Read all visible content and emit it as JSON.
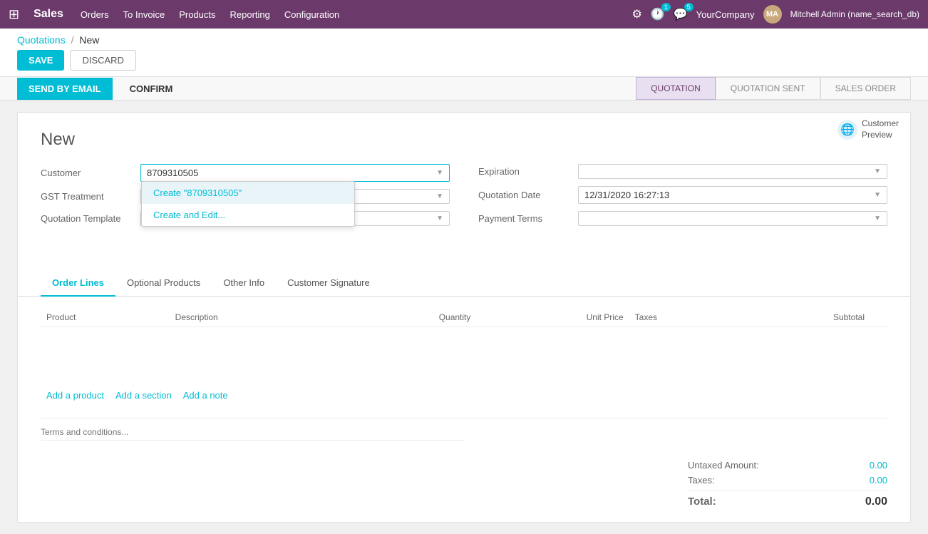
{
  "topnav": {
    "app_grid_icon": "⊞",
    "brand": "Sales",
    "menu_items": [
      {
        "label": "Orders",
        "id": "orders"
      },
      {
        "label": "To Invoice",
        "id": "to-invoice"
      },
      {
        "label": "Products",
        "id": "products"
      },
      {
        "label": "Reporting",
        "id": "reporting"
      },
      {
        "label": "Configuration",
        "id": "configuration"
      }
    ],
    "settings_icon": "⚙",
    "activity_count": "1",
    "messages_count": "5",
    "company": "YourCompany",
    "user": "Mitchell Admin (name_search_db)"
  },
  "breadcrumb": {
    "parent": "Quotations",
    "sep": "/",
    "current": "New"
  },
  "actions": {
    "save_label": "SAVE",
    "discard_label": "DISCARD"
  },
  "statusbar": {
    "send_email_label": "SEND BY EMAIL",
    "confirm_label": "CONFIRM",
    "steps": [
      {
        "label": "QUOTATION",
        "active": true
      },
      {
        "label": "QUOTATION SENT",
        "active": false
      },
      {
        "label": "SALES ORDER",
        "active": false
      }
    ]
  },
  "form": {
    "title": "New",
    "customer_preview_label": "Customer\nPreview",
    "fields_left": [
      {
        "label": "Customer",
        "value": "8709310505",
        "id": "customer",
        "has_dropdown": true
      },
      {
        "label": "GST Treatment",
        "value": "",
        "id": "gst-treatment",
        "has_dropdown": true
      },
      {
        "label": "Quotation Template",
        "value": "",
        "id": "quotation-template",
        "has_dropdown": true
      }
    ],
    "fields_right": [
      {
        "label": "Expiration",
        "value": "",
        "id": "expiration",
        "has_dropdown": true
      },
      {
        "label": "Quotation Date",
        "value": "12/31/2020 16:27:13",
        "id": "quotation-date",
        "has_dropdown": true
      },
      {
        "label": "Payment Terms",
        "value": "",
        "id": "payment-terms",
        "has_dropdown": true
      }
    ],
    "dropdown": {
      "items": [
        {
          "label": "Create \"8709310505\"",
          "highlighted": true,
          "id": "create-customer"
        },
        {
          "label": "Create and Edit...",
          "highlighted": false,
          "id": "create-edit"
        }
      ]
    },
    "tabs": [
      {
        "label": "Order Lines",
        "active": true
      },
      {
        "label": "Optional Products",
        "active": false
      },
      {
        "label": "Other Info",
        "active": false
      },
      {
        "label": "Customer Signature",
        "active": false
      }
    ],
    "table": {
      "columns": [
        {
          "label": "Product",
          "align": "left"
        },
        {
          "label": "Description",
          "align": "left"
        },
        {
          "label": "Quantity",
          "align": "right"
        },
        {
          "label": "Unit Price",
          "align": "right"
        },
        {
          "label": "Taxes",
          "align": "left"
        },
        {
          "label": "Subtotal",
          "align": "right"
        },
        {
          "label": "",
          "align": "left"
        }
      ],
      "actions": [
        {
          "label": "Add a product"
        },
        {
          "label": "Add a section"
        },
        {
          "label": "Add a note"
        }
      ]
    },
    "terms_placeholder": "Terms and conditions...",
    "totals": [
      {
        "label": "Untaxed Amount:",
        "value": "0.00"
      },
      {
        "label": "Taxes:",
        "value": "0.00"
      },
      {
        "label": "Total:",
        "value": "0.00",
        "is_final": true
      }
    ]
  }
}
